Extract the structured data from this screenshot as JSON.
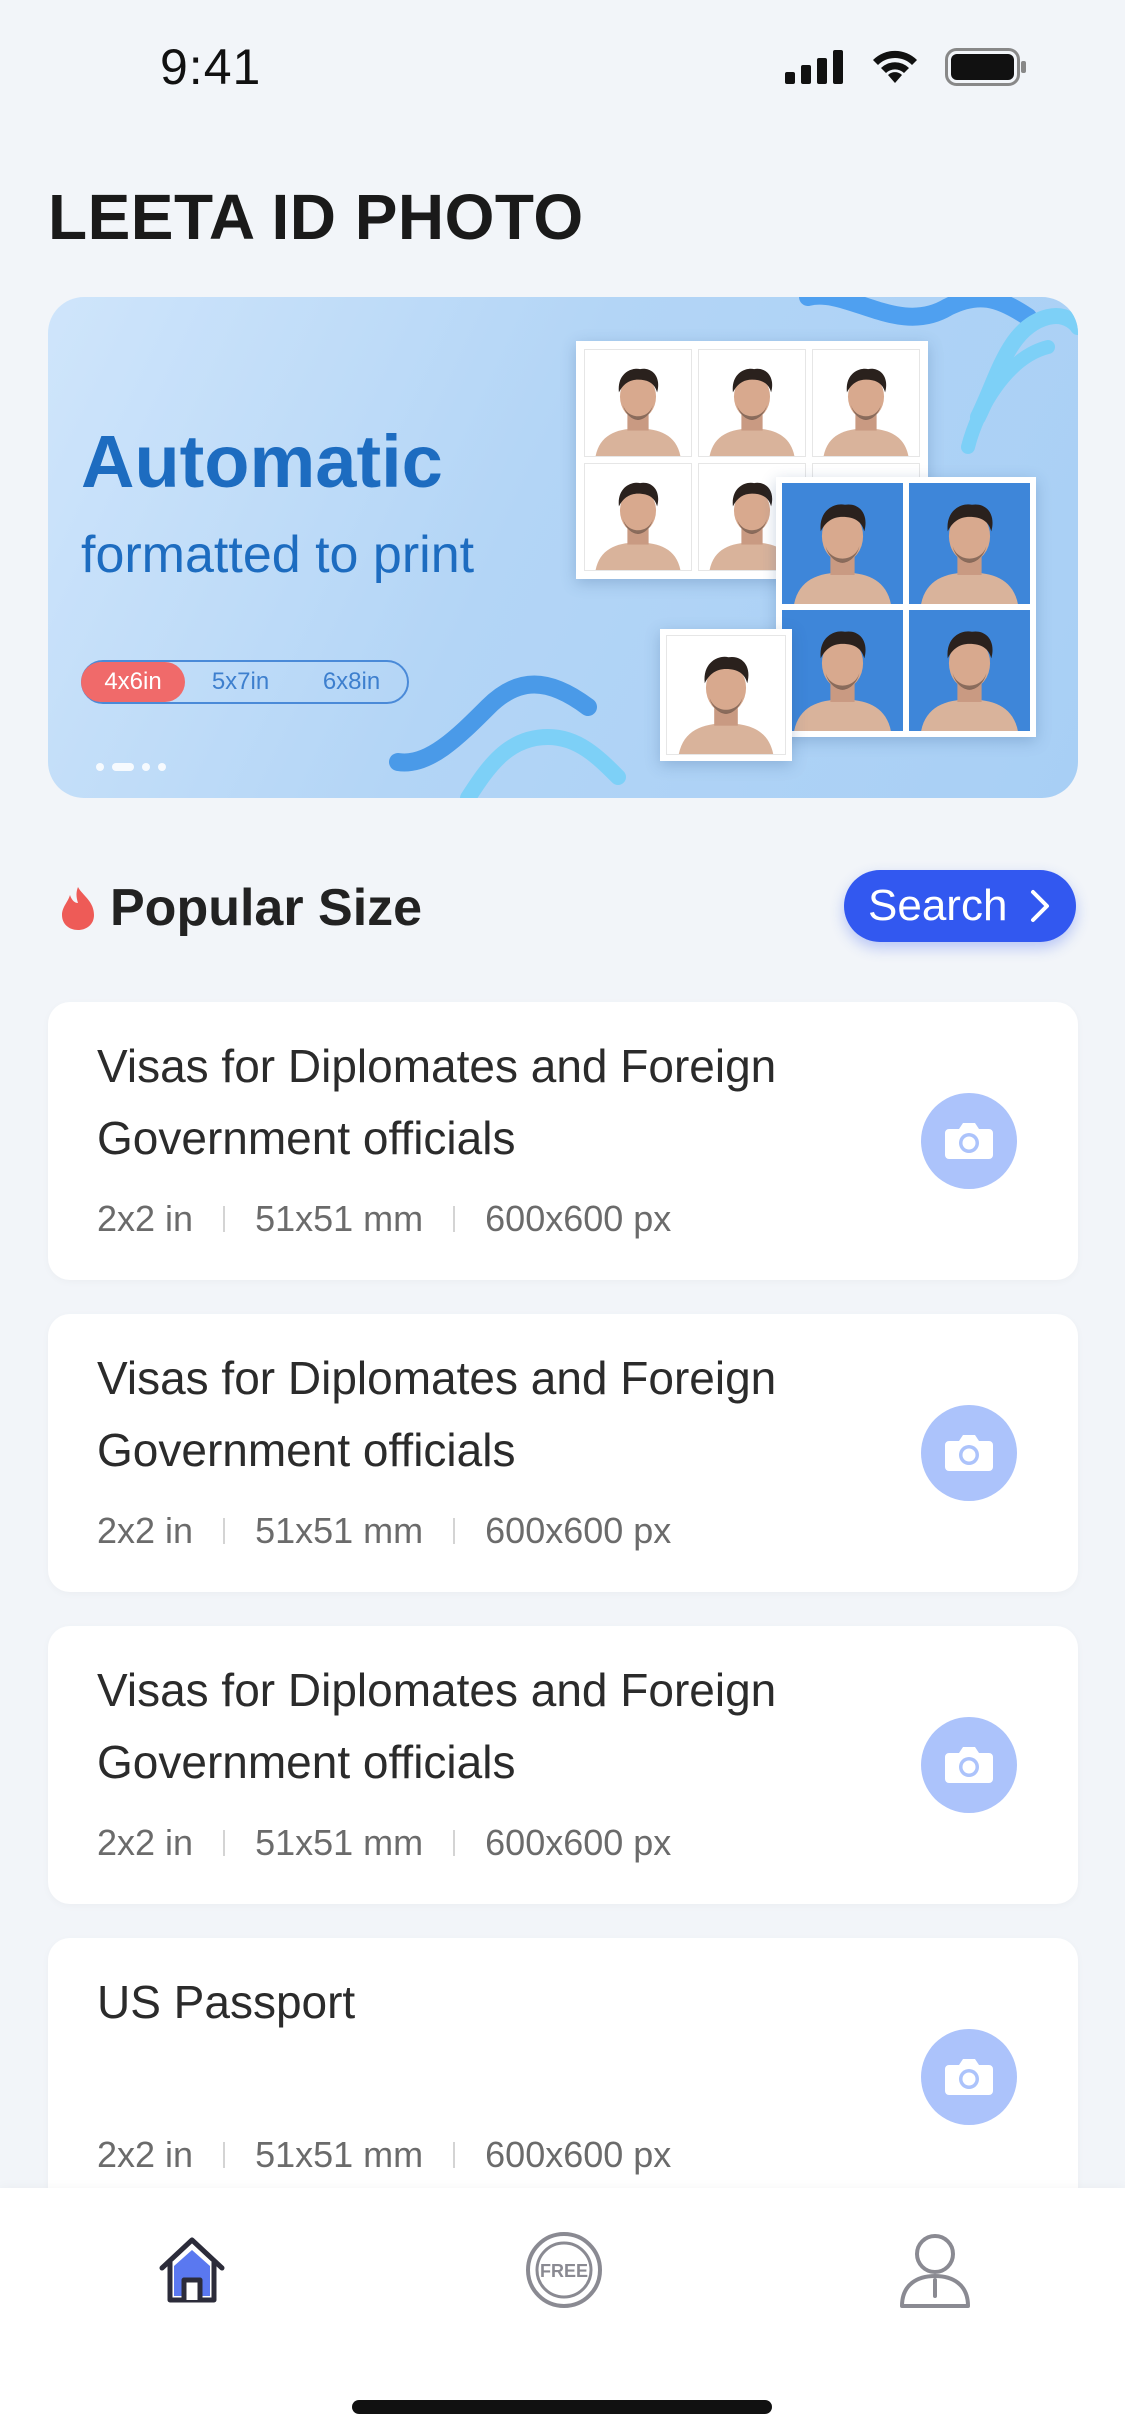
{
  "status_bar": {
    "time": "9:41"
  },
  "app": {
    "title": "LEETA ID PHOTO"
  },
  "banner": {
    "headline": "Automatic",
    "subheadline": "formatted to print",
    "sizes": [
      "4x6in",
      "5x7in",
      "6x8in"
    ],
    "active_size_index": 0,
    "page_count": 4,
    "active_page_index": 1
  },
  "popular": {
    "title": "Popular Size",
    "search_label": "Search"
  },
  "cards": [
    {
      "title": "Visas for Diplomates and Foreign Government officials",
      "spec_in": "2x2 in",
      "spec_mm": "51x51 mm",
      "spec_px": "600x600  px"
    },
    {
      "title": "Visas for Diplomates and Foreign Government officials",
      "spec_in": "2x2 in",
      "spec_mm": "51x51 mm",
      "spec_px": "600x600  px"
    },
    {
      "title": "Visas for Diplomates and Foreign Government officials",
      "spec_in": "2x2 in",
      "spec_mm": "51x51 mm",
      "spec_px": "600x600  px"
    },
    {
      "title": "US Passport",
      "spec_in": "2x2 in",
      "spec_mm": "51x51 mm",
      "spec_px": "600x600  px"
    }
  ],
  "tabs": [
    {
      "name": "home",
      "icon": "home-icon",
      "active": true
    },
    {
      "name": "free",
      "icon": "free-badge-icon",
      "label": "FREE",
      "active": false
    },
    {
      "name": "profile",
      "icon": "user-icon",
      "active": false
    }
  ],
  "colors": {
    "accent": "#3258f0",
    "banner_text": "#1d6cc0",
    "pill_active": "#f06a6a",
    "camera_button": "#acc3fb",
    "photo_blue_bg": "#3e86d9"
  }
}
